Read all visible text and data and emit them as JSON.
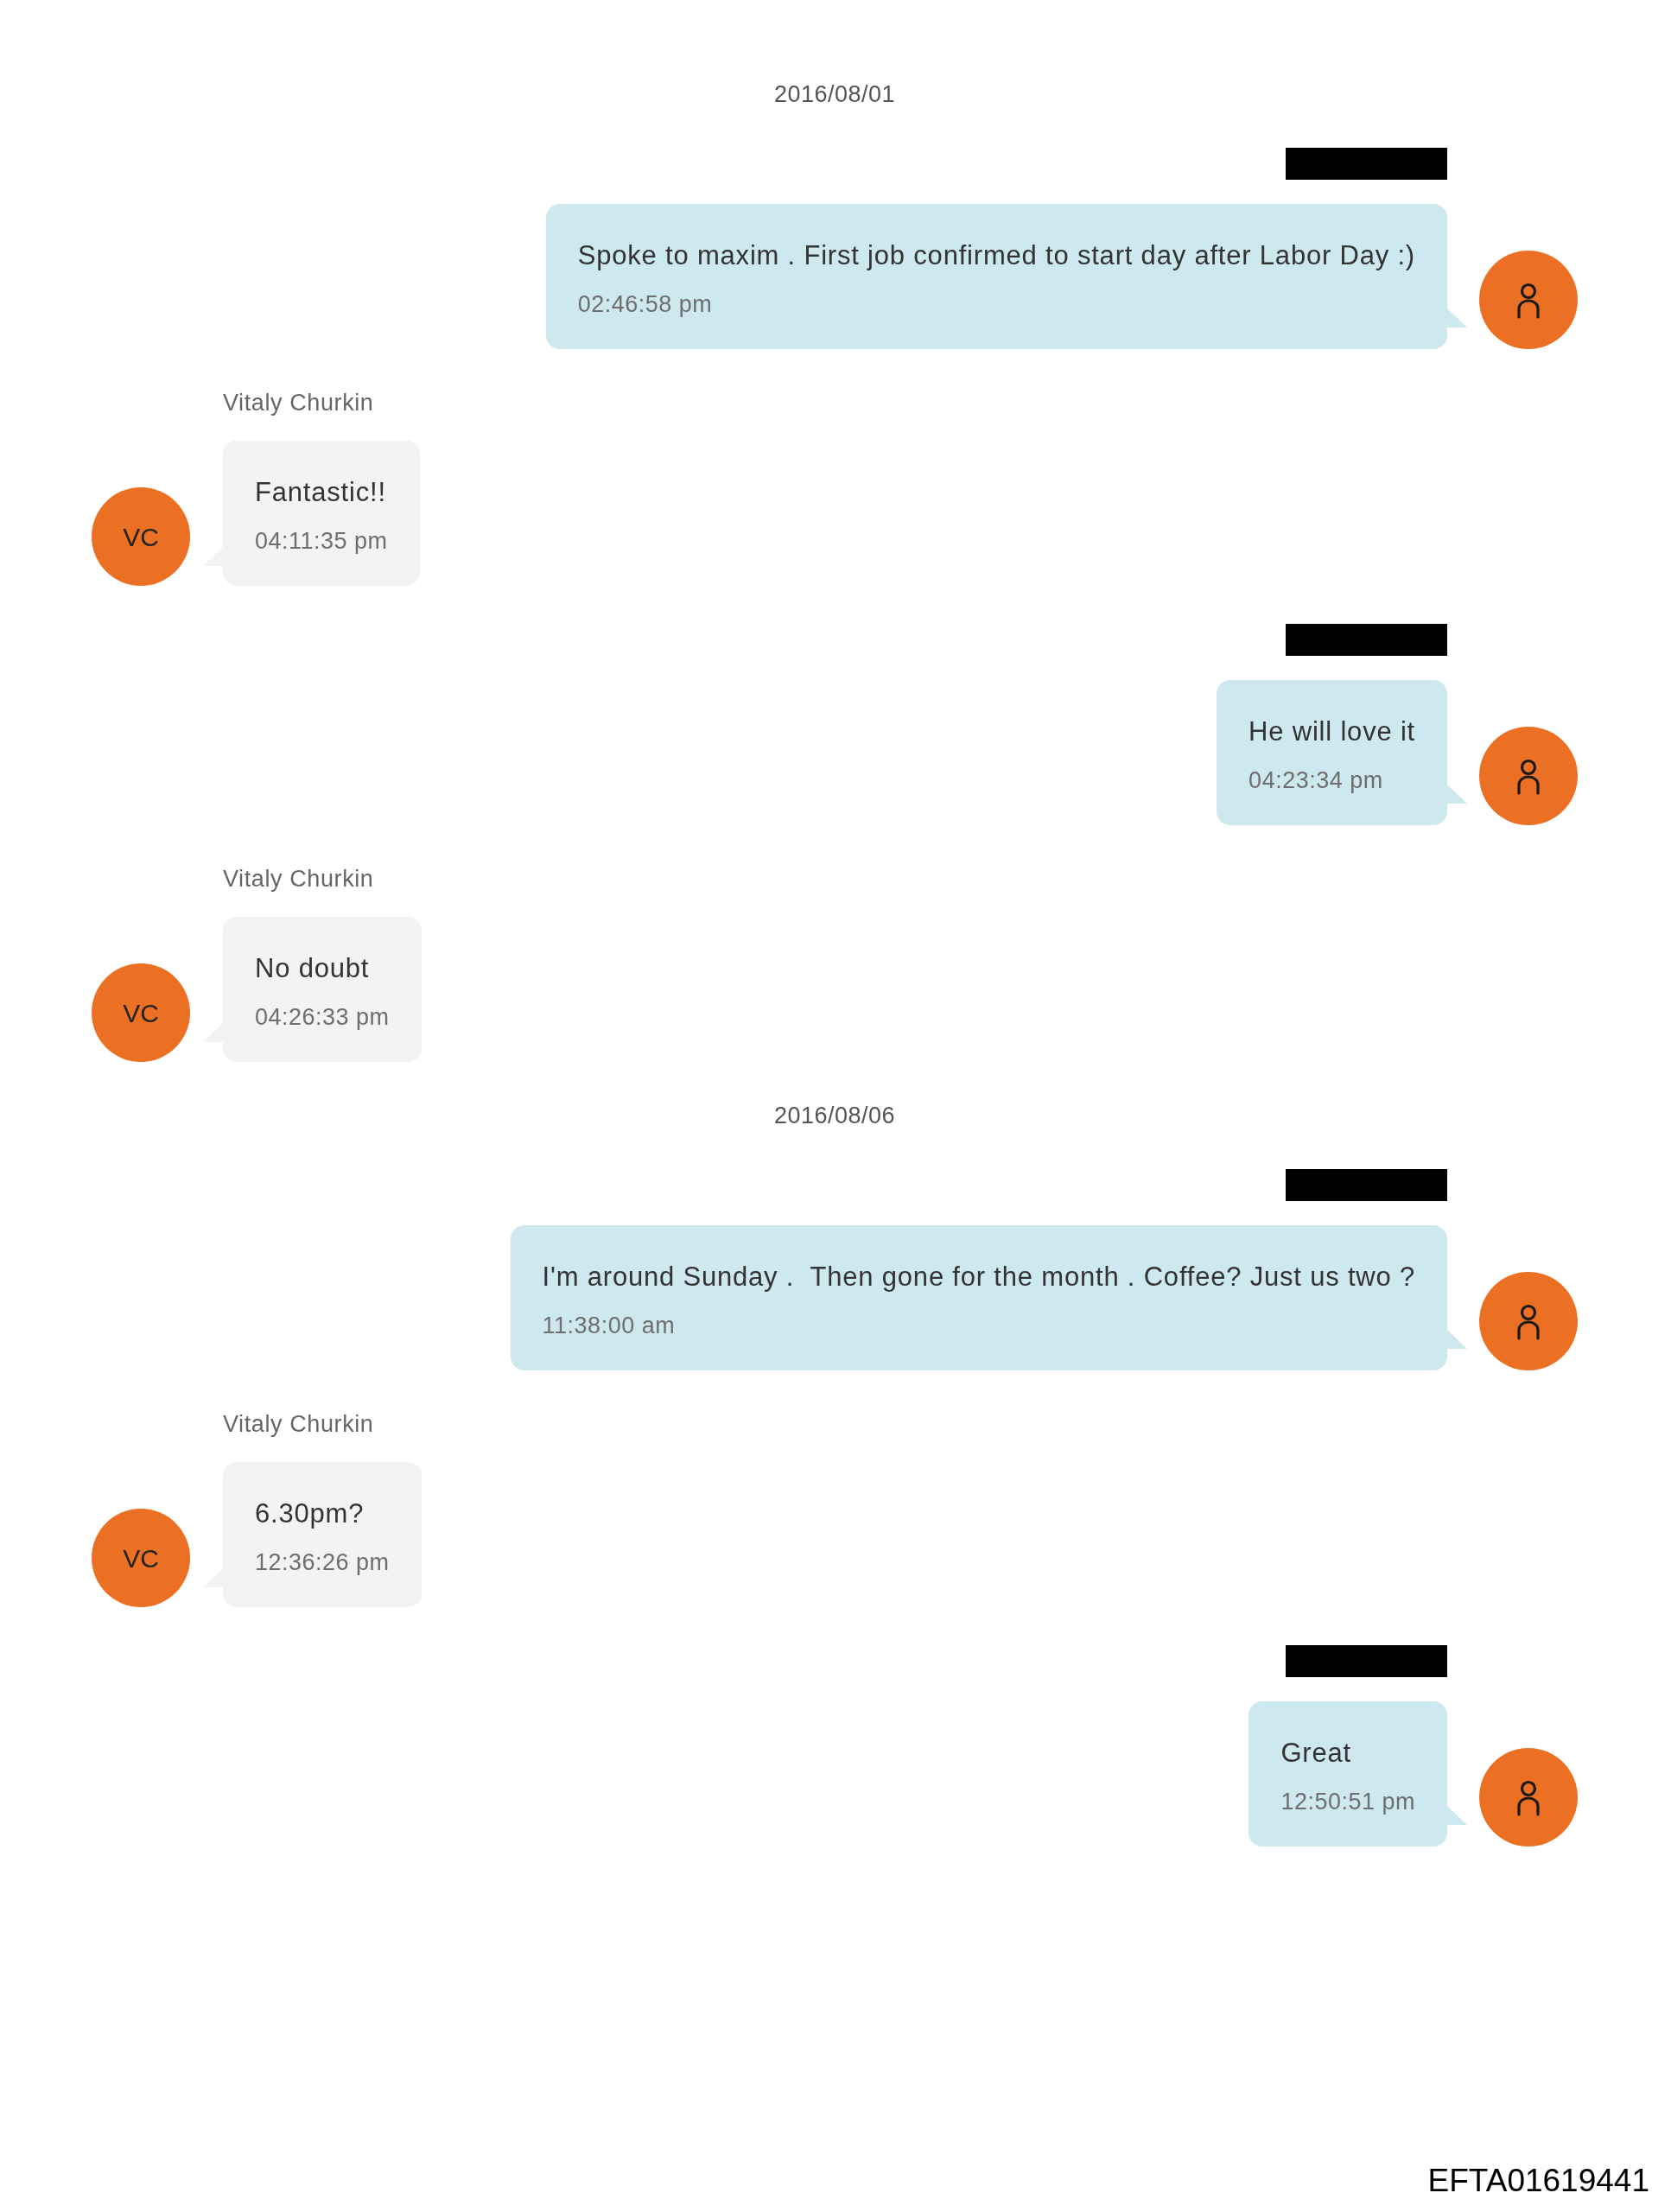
{
  "messages": [
    {
      "kind": "date",
      "text": "2016/08/01"
    },
    {
      "kind": "outgoing",
      "sender_redacted": true,
      "text": "Spoke to maxim . First job confirmed to start day after Labor Day :)",
      "time": "02:46:58 pm"
    },
    {
      "kind": "incoming",
      "sender": "Vitaly Churkin",
      "initials": "VC",
      "text": "Fantastic!!",
      "time": "04:11:35 pm"
    },
    {
      "kind": "outgoing",
      "sender_redacted": true,
      "text": "He will love it",
      "time": "04:23:34 pm"
    },
    {
      "kind": "incoming",
      "sender": "Vitaly Churkin",
      "initials": "VC",
      "text": "No doubt",
      "time": "04:26:33 pm"
    },
    {
      "kind": "date",
      "text": "2016/08/06"
    },
    {
      "kind": "outgoing",
      "sender_redacted": true,
      "text": "I'm around Sunday .  Then gone for the month . Coffee? Just us two ?",
      "time": "11:38:00 am"
    },
    {
      "kind": "incoming",
      "sender": "Vitaly Churkin",
      "initials": "VC",
      "text": "6.30pm?",
      "time": "12:36:26 pm"
    },
    {
      "kind": "outgoing",
      "sender_redacted": true,
      "text": "Great",
      "time": "12:50:51 pm"
    }
  ],
  "footer": {
    "document_id": "EFTA01619441"
  }
}
